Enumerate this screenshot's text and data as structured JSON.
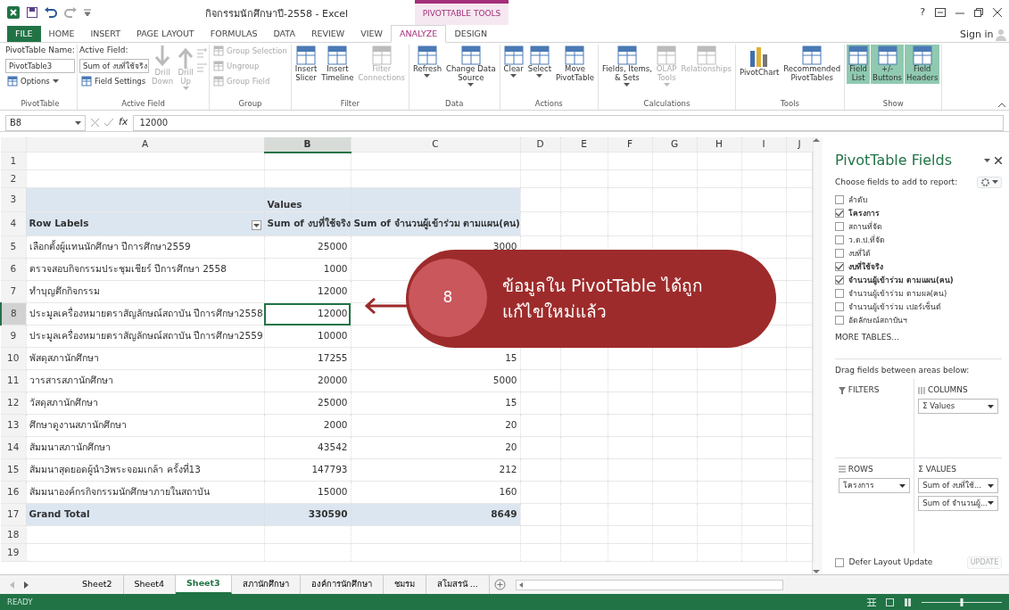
{
  "window": {
    "title": "กิจกรรมนักศึกษาปี-2558 - Excel",
    "help": "?",
    "sign_in": "Sign in"
  },
  "context_tab": "PIVOTTABLE TOOLS",
  "tabs": [
    {
      "label": "FILE",
      "kind": "file",
      "selected": false
    },
    {
      "label": "HOME",
      "selected": false
    },
    {
      "label": "INSERT",
      "selected": false
    },
    {
      "label": "PAGE LAYOUT",
      "selected": false
    },
    {
      "label": "FORMULAS",
      "selected": false
    },
    {
      "label": "DATA",
      "selected": false
    },
    {
      "label": "REVIEW",
      "selected": false
    },
    {
      "label": "VIEW",
      "selected": false
    },
    {
      "label": "ANALYZE",
      "selected": true
    },
    {
      "label": "DESIGN",
      "selected": false
    }
  ],
  "ribbon": {
    "groups": [
      {
        "label": "PivotTable",
        "items": [
          {
            "kind": "label",
            "text": "PivotTable Name:"
          },
          {
            "kind": "field",
            "value": "PivotTable3"
          },
          {
            "kind": "small",
            "label": "Options",
            "dropdown": true,
            "disabled": false
          }
        ]
      },
      {
        "label": "Active Field",
        "items": [
          {
            "kind": "label",
            "text": "Active Field:"
          },
          {
            "kind": "field",
            "value": "Sum of งบที่ใช้จริง"
          },
          {
            "kind": "small",
            "label": "Field Settings",
            "dropdown": false,
            "disabled": false
          },
          {
            "kind": "large",
            "lines": [
              "Drill",
              "Down"
            ],
            "disabled": true,
            "dropdown": false
          },
          {
            "kind": "large",
            "lines": [
              "Drill",
              "Up"
            ],
            "disabled": true,
            "dropdown": true
          },
          {
            "kind": "icons",
            "disabled": true
          }
        ]
      },
      {
        "label": "Group",
        "items": [
          {
            "kind": "small",
            "label": "Group Selection",
            "dropdown": false,
            "disabled": true
          },
          {
            "kind": "small",
            "label": "Ungroup",
            "dropdown": false,
            "disabled": true
          },
          {
            "kind": "small",
            "label": "Group Field",
            "dropdown": false,
            "disabled": true
          }
        ]
      },
      {
        "label": "Filter",
        "items": [
          {
            "kind": "large",
            "lines": [
              "Insert",
              "Slicer"
            ],
            "disabled": false,
            "dropdown": false
          },
          {
            "kind": "large",
            "lines": [
              "Insert",
              "Timeline"
            ],
            "disabled": false,
            "dropdown": false
          },
          {
            "kind": "large",
            "lines": [
              "Filter",
              "Connections"
            ],
            "disabled": true,
            "dropdown": false
          }
        ]
      },
      {
        "label": "Data",
        "items": [
          {
            "kind": "large",
            "lines": [
              "Refresh"
            ],
            "disabled": false,
            "dropdown": true
          },
          {
            "kind": "large",
            "lines": [
              "Change Data",
              "Source"
            ],
            "disabled": false,
            "dropdown": true
          }
        ]
      },
      {
        "label": "Actions",
        "items": [
          {
            "kind": "large",
            "lines": [
              "Clear"
            ],
            "disabled": false,
            "dropdown": true
          },
          {
            "kind": "large",
            "lines": [
              "Select"
            ],
            "disabled": false,
            "dropdown": true
          },
          {
            "kind": "large",
            "lines": [
              "Move",
              "PivotTable"
            ],
            "disabled": false,
            "dropdown": false
          }
        ]
      },
      {
        "label": "Calculations",
        "items": [
          {
            "kind": "large",
            "lines": [
              "Fields, Items,",
              "& Sets"
            ],
            "disabled": false,
            "dropdown": true
          },
          {
            "kind": "large",
            "lines": [
              "OLAP",
              "Tools"
            ],
            "disabled": true,
            "dropdown": true
          },
          {
            "kind": "large",
            "lines": [
              "Relationships"
            ],
            "disabled": true,
            "dropdown": false
          }
        ]
      },
      {
        "label": "Tools",
        "items": [
          {
            "kind": "large",
            "lines": [
              "PivotChart"
            ],
            "disabled": false,
            "dropdown": false
          },
          {
            "kind": "large",
            "lines": [
              "Recommended",
              "PivotTables"
            ],
            "disabled": false,
            "dropdown": false
          }
        ]
      },
      {
        "label": "Show",
        "items": [
          {
            "kind": "large",
            "lines": [
              "Field",
              "List"
            ],
            "disabled": false,
            "dropdown": false,
            "selected": true
          },
          {
            "kind": "large",
            "lines": [
              "+/-",
              "Buttons"
            ],
            "disabled": false,
            "dropdown": false,
            "selected": true
          },
          {
            "kind": "large",
            "lines": [
              "Field",
              "Headers"
            ],
            "disabled": false,
            "dropdown": false,
            "selected": true
          }
        ]
      }
    ]
  },
  "formula_bar": {
    "name_box": "B8",
    "function_label": "fx",
    "value": "12000"
  },
  "grid": {
    "columns": [
      {
        "label": "A",
        "selected": false
      },
      {
        "label": "B",
        "selected": true
      },
      {
        "label": "C",
        "selected": false
      },
      {
        "label": "D",
        "selected": false
      },
      {
        "label": "E",
        "selected": false
      },
      {
        "label": "F",
        "selected": false
      },
      {
        "label": "G",
        "selected": false
      },
      {
        "label": "H",
        "selected": false
      },
      {
        "label": "I",
        "selected": false
      },
      {
        "label": "J",
        "selected": false
      }
    ],
    "rows": [
      {
        "number": "1",
        "kind": "blank",
        "selected": false,
        "cells": [
          {
            "selected": false
          },
          {
            "selected": false
          },
          {
            "selected": false
          }
        ]
      },
      {
        "number": "2",
        "kind": "blank",
        "selected": false,
        "cells": [
          {
            "selected": false
          },
          {
            "selected": false
          },
          {
            "selected": false
          }
        ]
      },
      {
        "number": "3",
        "kind": "header",
        "selected": false,
        "cells": [
          {
            "selected": false
          },
          {
            "text": "Values",
            "selected": false
          },
          {
            "selected": false
          }
        ]
      },
      {
        "number": "4",
        "kind": "header",
        "selected": false,
        "cells": [
          {
            "text": "Row Labels",
            "filter": true,
            "selected": false
          },
          {
            "text": "Sum of งบที่ใช้จริง",
            "selected": false
          },
          {
            "text": "Sum of จำนวนผู้เข้าร่วม ตามแผน(คน)",
            "selected": false
          }
        ]
      },
      {
        "number": "5",
        "kind": "item",
        "selected": false,
        "cells": [
          {
            "text": "เลือกตั้งผู้แทนนักศึกษา ปีการศึกษา2559",
            "selected": false
          },
          {
            "text": "25000",
            "selected": false
          },
          {
            "text": "3000",
            "selected": false
          }
        ]
      },
      {
        "number": "6",
        "kind": "item",
        "selected": false,
        "cells": [
          {
            "text": "ตรวจสอบกิจกรรมประชุมเชียร์ ปีการศึกษา 2558",
            "selected": false
          },
          {
            "text": "1000",
            "selected": false
          },
          {
            "selected": false
          }
        ]
      },
      {
        "number": "7",
        "kind": "item",
        "selected": false,
        "cells": [
          {
            "text": "ทำบุญตึกกิจกรรม",
            "selected": false
          },
          {
            "text": "12000",
            "selected": false
          },
          {
            "selected": false
          }
        ]
      },
      {
        "number": "8",
        "kind": "item",
        "selected": true,
        "cells": [
          {
            "text": "ประมูลเครื่องหมายตราสัญลักษณ์สถาบัน ปีการศึกษา2558",
            "selected": false
          },
          {
            "text": "12000",
            "selected": true
          },
          {
            "selected": false
          }
        ]
      },
      {
        "number": "9",
        "kind": "item",
        "selected": false,
        "cells": [
          {
            "text": "ประมูลเครื่องหมายตราสัญลักษณ์สถาบัน ปีการศึกษา2559",
            "selected": false
          },
          {
            "text": "10000",
            "selected": false
          },
          {
            "selected": false
          }
        ]
      },
      {
        "number": "10",
        "kind": "item",
        "selected": false,
        "cells": [
          {
            "text": "พัสดุสภานักศึกษา",
            "selected": false
          },
          {
            "text": "17255",
            "selected": false
          },
          {
            "text": "15",
            "selected": false
          }
        ]
      },
      {
        "number": "11",
        "kind": "item",
        "selected": false,
        "cells": [
          {
            "text": "วารสารสภานักศึกษา",
            "selected": false
          },
          {
            "text": "20000",
            "selected": false
          },
          {
            "text": "5000",
            "selected": false
          }
        ]
      },
      {
        "number": "12",
        "kind": "item",
        "selected": false,
        "cells": [
          {
            "text": "วัสดุสภานักศึกษา",
            "selected": false
          },
          {
            "text": "25000",
            "selected": false
          },
          {
            "text": "15",
            "selected": false
          }
        ]
      },
      {
        "number": "13",
        "kind": "item",
        "selected": false,
        "cells": [
          {
            "text": "ศึกษาดูงานสภานักศึกษา",
            "selected": false
          },
          {
            "text": "2000",
            "selected": false
          },
          {
            "text": "20",
            "selected": false
          }
        ]
      },
      {
        "number": "14",
        "kind": "item",
        "selected": false,
        "cells": [
          {
            "text": "สัมมนาสภานักศึกษา",
            "selected": false
          },
          {
            "text": "43542",
            "selected": false
          },
          {
            "text": "20",
            "selected": false
          }
        ]
      },
      {
        "number": "15",
        "kind": "item",
        "selected": false,
        "cells": [
          {
            "text": "สัมมนาสุดยอดผู้นำ3พระจอมเกล้า ครั้งที่13",
            "selected": false
          },
          {
            "text": "147793",
            "selected": false
          },
          {
            "text": "212",
            "selected": false
          }
        ]
      },
      {
        "number": "16",
        "kind": "item",
        "selected": false,
        "cells": [
          {
            "text": "สัมมนาองค์กรกิจกรรมนักศึกษาภายในสถาบัน",
            "selected": false
          },
          {
            "text": "15000",
            "selected": false
          },
          {
            "text": "160",
            "selected": false
          }
        ]
      },
      {
        "number": "17",
        "kind": "total",
        "selected": false,
        "cells": [
          {
            "text": "Grand Total",
            "selected": false
          },
          {
            "text": "330590",
            "selected": false
          },
          {
            "text": "8649",
            "selected": false
          }
        ]
      },
      {
        "number": "18",
        "kind": "blank",
        "selected": false,
        "cells": [
          {
            "selected": false
          },
          {
            "selected": false
          },
          {
            "selected": false
          }
        ]
      },
      {
        "number": "19",
        "kind": "blank",
        "selected": false,
        "cells": [
          {
            "selected": false
          },
          {
            "selected": false
          },
          {
            "selected": false
          }
        ]
      }
    ]
  },
  "callout": {
    "number": "8",
    "lines": [
      "ข้อมูลใน PivotTable ได้ถูก",
      "แก้ไขใหม่แล้ว"
    ]
  },
  "sheet_tabs": [
    {
      "label": "Sheet2",
      "selected": false
    },
    {
      "label": "Sheet4",
      "selected": false
    },
    {
      "label": "Sheet3",
      "selected": true
    },
    {
      "label": "สภานักศึกษา",
      "selected": false
    },
    {
      "label": "องค์การนักศึกษา",
      "selected": false
    },
    {
      "label": "ชมรม",
      "selected": false
    },
    {
      "label": "สโมสรนั ...",
      "selected": false
    }
  ],
  "status_bar": {
    "text": "READY",
    "zoom": {
      "level": 0.5
    }
  },
  "field_list": {
    "title": "PivotTable Fields",
    "prompt": "Choose fields to add to report:",
    "fields": [
      {
        "label": "ลำดับ",
        "checked": false
      },
      {
        "label": "โครงการ",
        "checked": true
      },
      {
        "label": "สถานที่จัด",
        "checked": false
      },
      {
        "label": "ว.ด.ป.ที่จัด",
        "checked": false
      },
      {
        "label": "งบที่ได้",
        "checked": false
      },
      {
        "label": "งบที่ใช้จริง",
        "checked": true
      },
      {
        "label": "จำนวนผู้เข้าร่วม ตามแผน(คน)",
        "checked": true
      },
      {
        "label": "จำนวนผู้เข้าร่วม ตามผล(คน)",
        "checked": false
      },
      {
        "label": "จำนวนผู้เข้าร่วม เปอร์เซ็นต์",
        "checked": false
      },
      {
        "label": "อัตลักษณ์สถาบันฯ",
        "checked": false
      }
    ],
    "more_tables": "MORE TABLES...",
    "drag_hint": "Drag fields between areas below:",
    "areas": [
      {
        "title": "FILTERS",
        "kind": "filters"
      },
      {
        "title": "COLUMNS",
        "kind": "columns",
        "items": [
          "Σ  Values"
        ]
      },
      {
        "title": "ROWS",
        "kind": "rows",
        "items": [
          "โครงการ"
        ]
      },
      {
        "title": "VALUES",
        "kind": "values",
        "symbol": "Σ",
        "items": [
          "Sum of งบที่ใช้...",
          "Sum of จำนวนผู้..."
        ]
      }
    ],
    "defer": {
      "label": "Defer Layout Update",
      "checked": false
    },
    "update_button": {
      "label": "UPDATE",
      "disabled": true
    }
  }
}
